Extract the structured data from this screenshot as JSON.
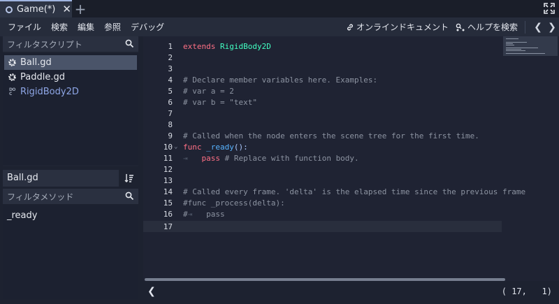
{
  "tabs": [
    {
      "label": "Game(*)"
    }
  ],
  "menu": {
    "items": [
      "ファイル",
      "検索",
      "編集",
      "参照",
      "デバッグ"
    ],
    "online_docs": "オンラインドキュメント",
    "search_help": "ヘルプを検索",
    "prev": "❮",
    "next": "❯"
  },
  "scripts": {
    "filter_placeholder": "フィルタスクリプト",
    "items": [
      {
        "name": "Ball.gd",
        "icon": "gear-icon",
        "selected": true
      },
      {
        "name": "Paddle.gd",
        "icon": "gear-icon",
        "selected": false
      },
      {
        "name": "RigidBody2D",
        "icon": "doc-icon",
        "selected": false
      }
    ],
    "doc_icon_text_1": "DO",
    "doc_icon_text_2": "C"
  },
  "methods": {
    "current_file": "Ball.gd",
    "filter_placeholder": "フィルタメソッド",
    "items": [
      "_ready"
    ]
  },
  "editor": {
    "line_numbers": [
      "1",
      "2",
      "3",
      "4",
      "5",
      "6",
      "7",
      "8",
      "9",
      "10",
      "11",
      "12",
      "13",
      "14",
      "15",
      "16",
      "17"
    ],
    "lines": {
      "l1_kw": "extends",
      "l1_type": "RigidBody2D",
      "l4": "# Declare member variables here. Examples:",
      "l5": "# var a = 2",
      "l6": "# var b = \"text\"",
      "l9": "# Called when the node enters the scene tree for the first time.",
      "l10_kw": "func",
      "l10_fn": "_ready",
      "l10_rest": "():",
      "l11_tab": "⇥",
      "l11_kw": "pass",
      "l11_cm": " # Replace with function body.",
      "l14": "# Called every frame. 'delta' is the elapsed time since the previous frame",
      "l15": "#func _process(delta):",
      "l16_a": "#",
      "l16_tab": "⇥",
      "l16_b": "   pass"
    },
    "current_line": 17
  },
  "status": {
    "collapse": "❮",
    "position": "( 17,   1)"
  },
  "colors": {
    "keyword": "#ff7085",
    "type": "#42ffc2",
    "comment": "#8c93a1",
    "function": "#57b3ff"
  }
}
